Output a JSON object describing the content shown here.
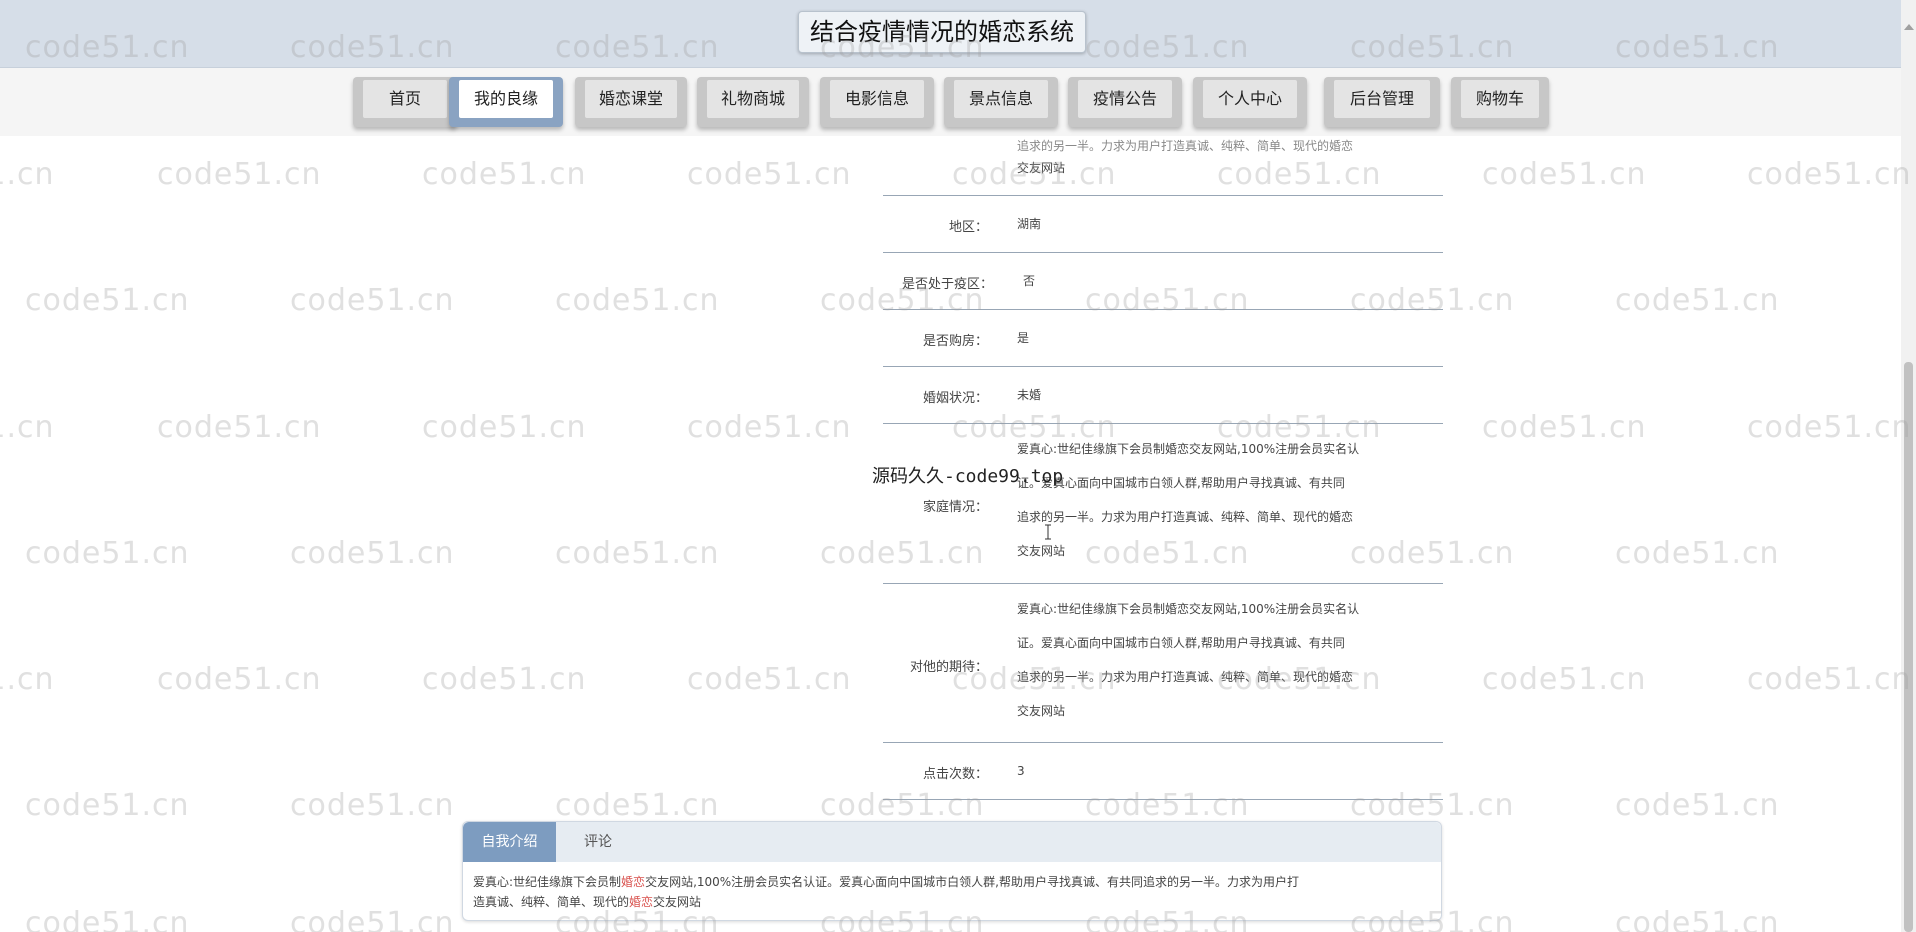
{
  "header": {
    "title": "结合疫情情况的婚恋系统"
  },
  "nav": {
    "items": [
      {
        "label": "首页",
        "active": false
      },
      {
        "label": "我的良缘",
        "active": true
      },
      {
        "label": "婚恋课堂",
        "active": false
      },
      {
        "label": "礼物商城",
        "active": false
      },
      {
        "label": "电影信息",
        "active": false
      },
      {
        "label": "景点信息",
        "active": false
      },
      {
        "label": "疫情公告",
        "active": false
      },
      {
        "label": "个人中心",
        "active": false
      },
      {
        "label": "后台管理",
        "active": false
      },
      {
        "label": "购物车",
        "active": false
      }
    ]
  },
  "detail": {
    "top_fragment": "追求的另一半。力求为用户打造真诚、纯粹、简单、现代的婚恋",
    "top_fragment_tail": "交友网站",
    "rows": [
      {
        "label": "地区：",
        "value": "湖南"
      },
      {
        "label": "是否处于疫区：",
        "value": "否"
      },
      {
        "label": "是否购房：",
        "value": "是"
      },
      {
        "label": "婚姻状况：",
        "value": "未婚"
      },
      {
        "label": "家庭情况：",
        "lines": [
          "爱真心:世纪佳缘旗下会员制婚恋交友网站,100%注册会员实名认",
          "证。爱真心面向中国城市白领人群,帮助用户寻找真诚、有共同",
          "追求的另一半。力求为用户打造真诚、纯粹、简单、现代的婚恋",
          "交友网站"
        ]
      },
      {
        "label": "对他的期待：",
        "lines": [
          "爱真心:世纪佳缘旗下会员制婚恋交友网站,100%注册会员实名认",
          "证。爱真心面向中国城市白领人群,帮助用户寻找真诚、有共同",
          "追求的另一半。力求为用户打造真诚、纯粹、简单、现代的婚恋",
          "交友网站"
        ]
      },
      {
        "label": "点击次数：",
        "value": "3"
      }
    ]
  },
  "tabs": {
    "items": [
      {
        "label": "自我介绍",
        "active": true
      },
      {
        "label": "评论",
        "active": false
      }
    ],
    "content": {
      "part1": "爱真心:世纪佳缘旗下会员制",
      "hl1": "婚恋",
      "part2": "交友网站,100%注册会员实名认证。爱真心面向中国城市白领人群,帮助用户寻找真诚、有共同追求的另一半。力求为用户打",
      "part3": "造真诚、纯粹、简单、现代的",
      "hl2": "婚恋",
      "part4": "交友网站"
    }
  },
  "watermarks": {
    "text": "code51.cn",
    "source": "源码久久-code99.top"
  },
  "colors": {
    "header_bg": "#d6dee8",
    "nav_active": "#8aa3c2",
    "tab_active": "#7d9cc0",
    "highlight": "#d9534f"
  }
}
